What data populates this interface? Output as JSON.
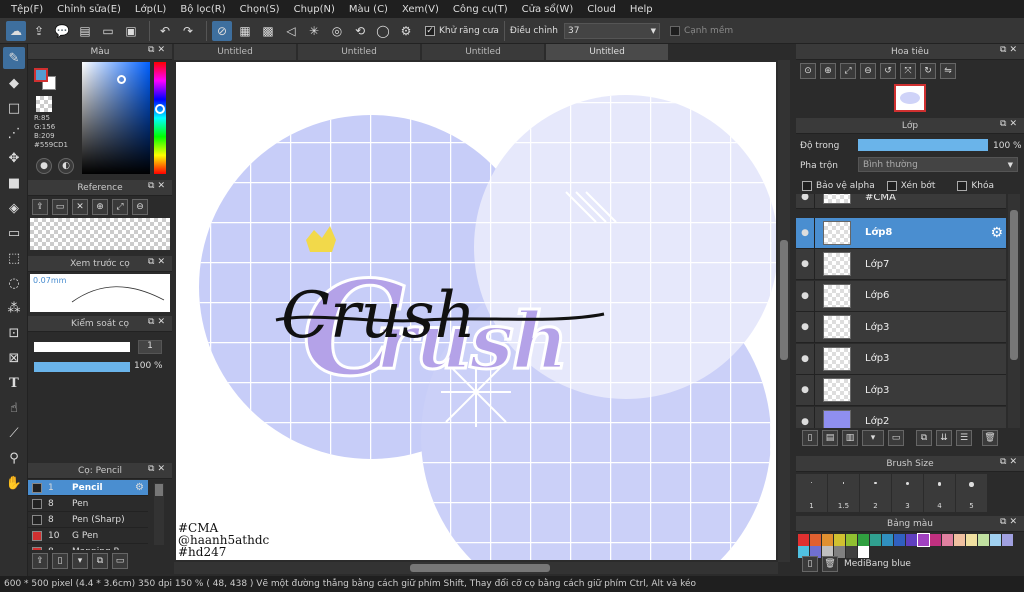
{
  "menu": [
    "Tệp(F)",
    "Chỉnh sửa(E)",
    "Lớp(L)",
    "Bộ lọc(R)",
    "Chọn(S)",
    "Chụp(N)",
    "Màu (C)",
    "Xem(V)",
    "Công cụ(T)",
    "Cửa sổ(W)",
    "Cloud",
    "Help"
  ],
  "toolbar": {
    "antialias_label": "Khử răng cưa",
    "adjust_label": "Điều chỉnh",
    "adjust_value": "37",
    "smooth_edge_label": "Cạnh mềm"
  },
  "color_panel": {
    "title": "Màu",
    "r": "R:85",
    "g": "G:156",
    "b": "B:209",
    "hex": "#559CD1",
    "fg_color": "#559CD1"
  },
  "reference_panel": {
    "title": "Reference"
  },
  "brush_preview": {
    "title": "Xem trước cọ",
    "size": "0.07mm"
  },
  "brush_control": {
    "title": "Kiểm soát cọ",
    "size_value": "1",
    "opacity_value": "100 %"
  },
  "brush_list": {
    "title": "Cọ: Pencil",
    "items": [
      {
        "size": "1",
        "name": "Pencil",
        "color": "#222222"
      },
      {
        "size": "8",
        "name": "Pen",
        "color": "#222222"
      },
      {
        "size": "8",
        "name": "Pen (Sharp)",
        "color": "#222222"
      },
      {
        "size": "10",
        "name": "G Pen",
        "color": "#d03030"
      },
      {
        "size": "8",
        "name": "Mapping P...",
        "color": "#d03030"
      }
    ]
  },
  "tabs": [
    "Untitled",
    "Untitled",
    "Untitled",
    "Untitled"
  ],
  "artwork": {
    "title": "Crush",
    "watermark_1": "#CMA",
    "watermark_2": "@haanh5athdc",
    "watermark_3": "#hd247"
  },
  "navigator": {
    "title": "Hoa tiêu"
  },
  "layer_panel": {
    "title": "Lớp",
    "opacity_label": "Độ trong",
    "opacity_value": "100 %",
    "blend_label": "Pha trộn",
    "blend_value": "Bình thường",
    "protect_alpha": "Bảo vệ alpha",
    "clipping": "Xén bớt",
    "lock": "Khóa",
    "layers": [
      "#CMA",
      "Lớp8",
      "Lớp7",
      "Lớp6",
      "Lớp3",
      "Lớp3",
      "Lớp3",
      "Lớp2"
    ]
  },
  "brush_size_panel": {
    "title": "Brush Size",
    "sizes": [
      "1",
      "1.5",
      "2",
      "3",
      "4",
      "5"
    ]
  },
  "palette_panel": {
    "title": "Bảng màu",
    "palette_name": "MediBang blue",
    "colors": [
      "#e03030",
      "#e06030",
      "#e09030",
      "#d0c030",
      "#90c030",
      "#30a040",
      "#30a090",
      "#3090c0",
      "#3060c0",
      "#6040c0",
      "#a040c0",
      "#c03080",
      "#e080a0",
      "#f0c0a0",
      "#f0e0a0",
      "#c0e0a0",
      "#a0d0f0",
      "#a0a0e0",
      "#50c0e0",
      "#7070d0",
      "#c0c0c0",
      "#808080",
      "#404040",
      "#ffffff"
    ]
  },
  "status": "600 * 500 pixel   (4.4 * 3.6cm)   350 dpi   150 %   ( 48, 438 )   Vẽ một đường thẳng bằng cách giữ phím Shift, Thay đổi cỡ cọ bằng cách giữ phím Ctrl, Alt và kéo"
}
